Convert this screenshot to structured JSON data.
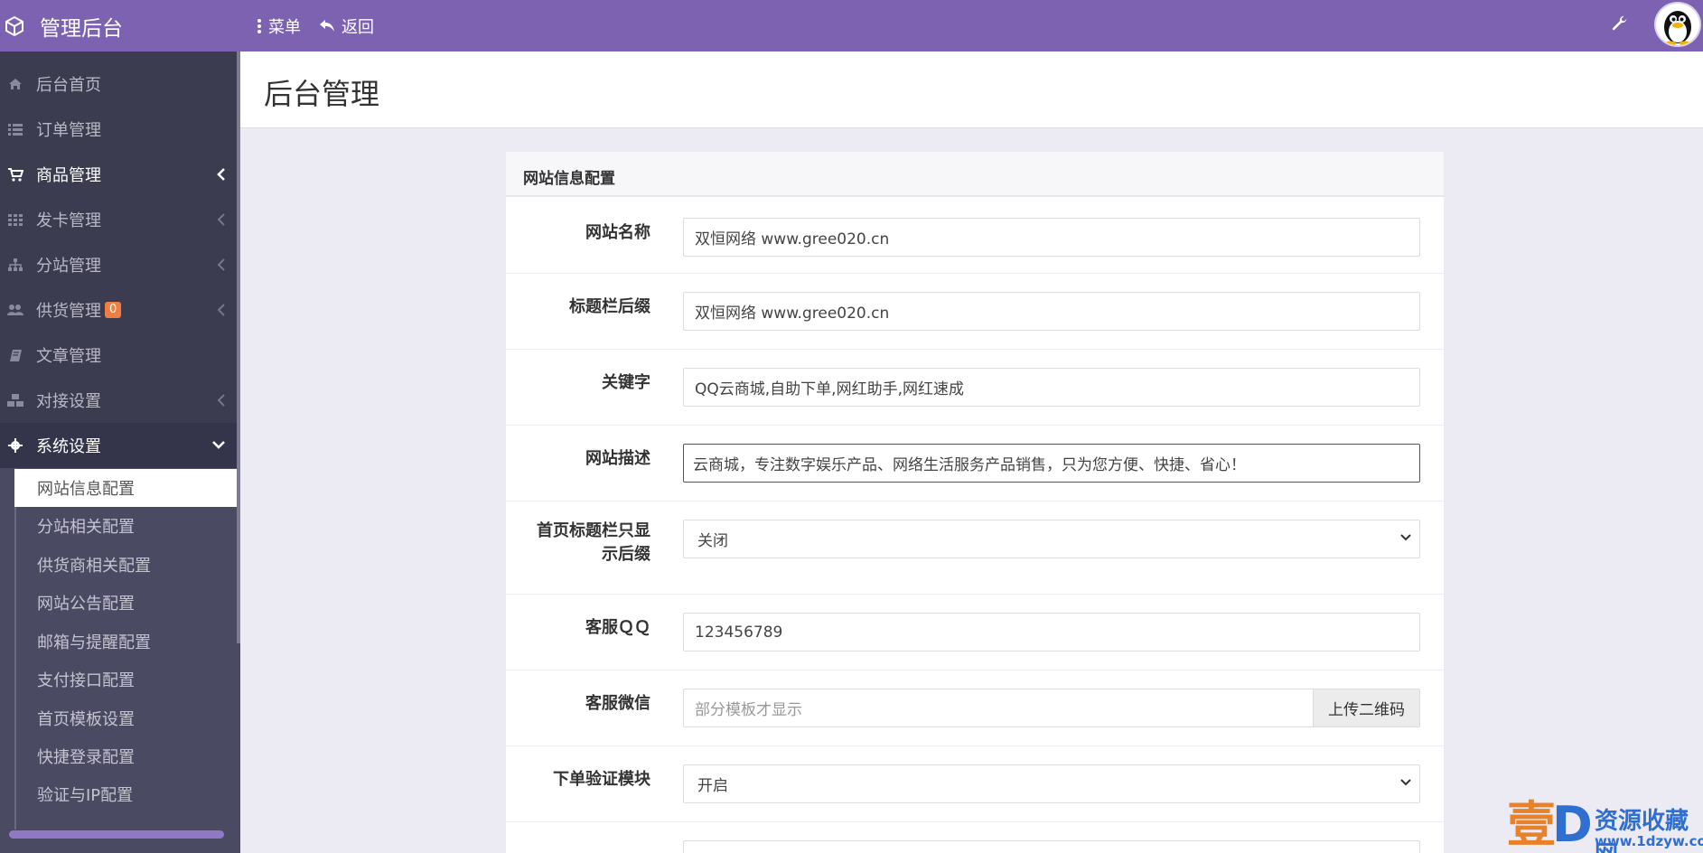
{
  "app": {
    "title": "管理后台"
  },
  "topnav": {
    "menu": "菜单",
    "back": "返回"
  },
  "sidebar": {
    "items": [
      {
        "label": "后台首页"
      },
      {
        "label": "订单管理"
      },
      {
        "label": "商品管理"
      },
      {
        "label": "发卡管理"
      },
      {
        "label": "分站管理"
      },
      {
        "label": "供货管理",
        "badge": "0"
      },
      {
        "label": "文章管理"
      },
      {
        "label": "对接设置"
      },
      {
        "label": "系统设置"
      }
    ],
    "subitems": [
      {
        "label": "网站信息配置"
      },
      {
        "label": "分站相关配置"
      },
      {
        "label": "供货商相关配置"
      },
      {
        "label": "网站公告配置"
      },
      {
        "label": "邮箱与提醒配置"
      },
      {
        "label": "支付接口配置"
      },
      {
        "label": "首页模板设置"
      },
      {
        "label": "快捷登录配置"
      },
      {
        "label": "验证与IP配置"
      }
    ]
  },
  "page": {
    "title": "后台管理"
  },
  "card": {
    "title": "网站信息配置"
  },
  "form": {
    "site_name": {
      "label": "网站名称",
      "value": "双恒网络  www.gree020.cn"
    },
    "title_suffix": {
      "label": "标题栏后缀",
      "value": "双恒网络  www.gree020.cn"
    },
    "keywords": {
      "label": "关键字",
      "value": "QQ云商城,自助下单,网红助手,网红速成"
    },
    "description": {
      "label": "网站描述",
      "value": "云商城，专注数字娱乐产品、网络生活服务产品销售，只为您方便、快捷、省心！"
    },
    "home_title_suffix_only": {
      "label_line1": "首页标题栏只显",
      "label_line2": "示后缀",
      "value": "关闭"
    },
    "service_qq": {
      "label": "客服ＱＱ",
      "value": "123456789"
    },
    "service_wechat": {
      "label": "客服微信",
      "placeholder": "部分模板才显示",
      "upload": "上传二维码"
    },
    "order_verify": {
      "label": "下单验证模块",
      "value": "开启"
    }
  },
  "watermark": {
    "big1": "壹",
    "big2": "D",
    "line1": "资源收藏网",
    "line2": "www.1dzyw.com"
  },
  "colors": {
    "topbar": "#7c62b0",
    "sidebar": "#3c3c50",
    "accent": "#8f78c4",
    "badge": "#f07e44"
  }
}
